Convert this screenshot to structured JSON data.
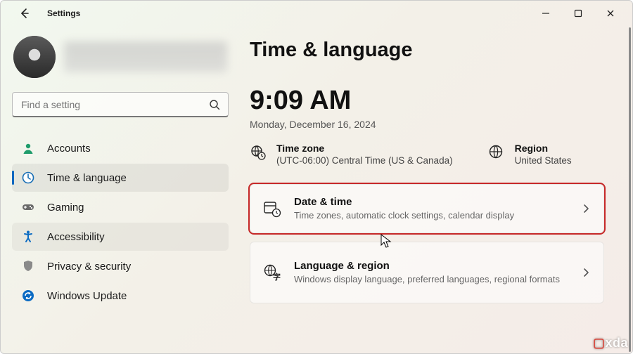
{
  "window": {
    "title": "Settings"
  },
  "search": {
    "placeholder": "Find a setting"
  },
  "nav": {
    "items": [
      {
        "label": "Accounts"
      },
      {
        "label": "Time & language"
      },
      {
        "label": "Gaming"
      },
      {
        "label": "Accessibility"
      },
      {
        "label": "Privacy & security"
      },
      {
        "label": "Windows Update"
      }
    ],
    "selected_index": 1
  },
  "page": {
    "heading": "Time & language",
    "clock": "9:09 AM",
    "date": "Monday, December 16, 2024",
    "timezone": {
      "label": "Time zone",
      "value": "(UTC-06:00) Central Time (US & Canada)"
    },
    "region": {
      "label": "Region",
      "value": "United States"
    },
    "cards": [
      {
        "title": "Date & time",
        "subtitle": "Time zones, automatic clock settings, calendar display"
      },
      {
        "title": "Language & region",
        "subtitle": "Windows display language, preferred languages, regional formats"
      }
    ]
  },
  "watermark": "xda"
}
